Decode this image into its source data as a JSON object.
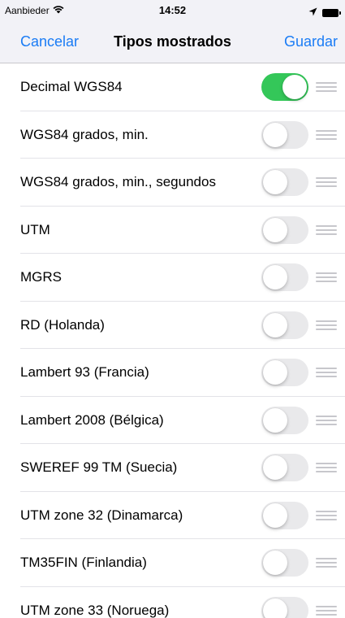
{
  "status_bar": {
    "carrier": "Aanbieder",
    "time": "14:52",
    "wifi_icon": "wifi-icon",
    "location_icon": "location-arrow-icon",
    "battery_icon": "battery-icon"
  },
  "nav": {
    "cancel_label": "Cancelar",
    "title": "Tipos mostrados",
    "save_label": "Guardar"
  },
  "colors": {
    "accent": "#1a7cf5",
    "toggle_on": "#34c759",
    "toggle_off": "#e9e9eb"
  },
  "items": [
    {
      "label": "Decimal WGS84",
      "enabled": true
    },
    {
      "label": "WGS84 grados, min.",
      "enabled": false
    },
    {
      "label": "WGS84 grados, min., segundos",
      "enabled": false
    },
    {
      "label": "UTM",
      "enabled": false
    },
    {
      "label": "MGRS",
      "enabled": false
    },
    {
      "label": "RD (Holanda)",
      "enabled": false
    },
    {
      "label": "Lambert 93 (Francia)",
      "enabled": false
    },
    {
      "label": "Lambert 2008 (Bélgica)",
      "enabled": false
    },
    {
      "label": "SWEREF 99 TM (Suecia)",
      "enabled": false
    },
    {
      "label": "UTM zone 32 (Dinamarca)",
      "enabled": false
    },
    {
      "label": "TM35FIN (Finlandia)",
      "enabled": false
    },
    {
      "label": "UTM zone 33 (Noruega)",
      "enabled": false
    }
  ]
}
